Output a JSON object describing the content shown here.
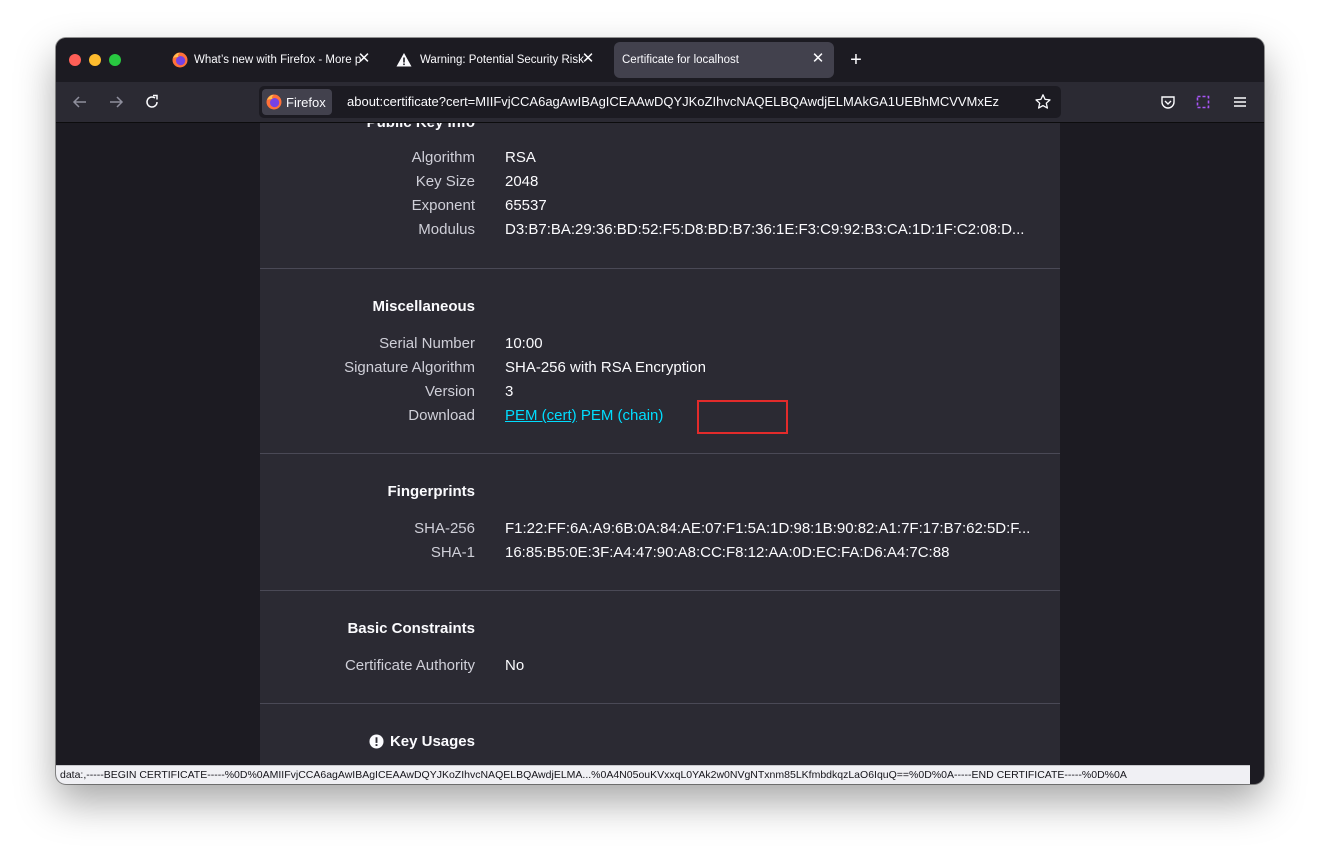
{
  "tabs": [
    {
      "title": "What’s new with Firefox - More p",
      "active": false
    },
    {
      "title": "Warning: Potential Security Risk",
      "active": false
    },
    {
      "title": "Certificate for localhost",
      "active": true
    }
  ],
  "tab_close_glyph": "✕",
  "new_tab_glyph": "+",
  "urlbar": {
    "identity_label": "Firefox",
    "url": "about:certificate?cert=MIIFvjCCA6agAwIBAgICEAAwDQYJKoZIhvcNAQELBQAwdjELMAkGA1UEBhMCVVMxEz"
  },
  "public_key_info": {
    "title": "Public Key Info",
    "rows": [
      {
        "label": "Algorithm",
        "value": "RSA"
      },
      {
        "label": "Key Size",
        "value": "2048"
      },
      {
        "label": "Exponent",
        "value": "65537"
      },
      {
        "label": "Modulus",
        "value": "D3:B7:BA:29:36:BD:52:F5:D8:BD:B7:36:1E:F3:C9:92:B3:CA:1D:1F:C2:08:D..."
      }
    ]
  },
  "miscellaneous": {
    "title": "Miscellaneous",
    "rows": [
      {
        "label": "Serial Number",
        "value": "10:00"
      },
      {
        "label": "Signature Algorithm",
        "value": "SHA-256 with RSA Encryption"
      },
      {
        "label": "Version",
        "value": "3"
      }
    ],
    "download_label": "Download",
    "download_links": [
      "PEM (cert)",
      "PEM (chain)"
    ]
  },
  "fingerprints": {
    "title": "Fingerprints",
    "rows": [
      {
        "label": "SHA-256",
        "value": "F1:22:FF:6A:A9:6B:0A:84:AE:07:F1:5A:1D:98:1B:90:82:A1:7F:17:B7:62:5D:F..."
      },
      {
        "label": "SHA-1",
        "value": "16:85:B5:0E:3F:A4:47:90:A8:CC:F8:12:AA:0D:EC:FA:D6:A4:7C:88"
      }
    ]
  },
  "basic_constraints": {
    "title": "Basic Constraints",
    "rows": [
      {
        "label": "Certificate Authority",
        "value": "No"
      }
    ]
  },
  "key_usages": {
    "title": "Key Usages",
    "icon": "alert-circle-icon"
  },
  "status_bar": "data:,-----BEGIN CERTIFICATE-----%0D%0AMIIFvjCCA6agAwIBAgICEAAwDQYJKoZIhvcNAQELBQAwdjELMA...%0A4N05ouKVxxqL0YAk2w0NVgNTxnm85LKfmbdkqzLaO6IquQ==%0D%0A-----END CERTIFICATE-----%0D%0A",
  "colors": {
    "link": "#00ddff",
    "highlight_box": "#e22b2b",
    "panel": "#2b2a33",
    "page_bg": "#1c1b22"
  }
}
